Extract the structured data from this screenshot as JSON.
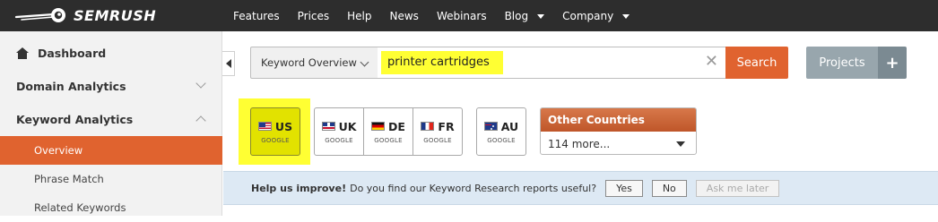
{
  "brand": {
    "logo_text": "SEMRUSH"
  },
  "nav": {
    "items": [
      {
        "label": "Features"
      },
      {
        "label": "Prices"
      },
      {
        "label": "Help"
      },
      {
        "label": "News"
      },
      {
        "label": "Webinars"
      },
      {
        "label": "Blog"
      },
      {
        "label": "Company"
      }
    ]
  },
  "sidebar": {
    "dashboard": "Dashboard",
    "domain_analytics": "Domain Analytics",
    "keyword_analytics": "Keyword Analytics",
    "sub_items": [
      {
        "label": "Overview",
        "active": true
      },
      {
        "label": "Phrase Match"
      },
      {
        "label": "Related Keywords"
      }
    ]
  },
  "search": {
    "database_select": "Keyword Overview",
    "query_value": "printer cartridges",
    "clear_glyph": "✕",
    "search_button": "Search",
    "projects_button": "Projects",
    "add_button": "+"
  },
  "countries": {
    "buttons": [
      {
        "code": "US",
        "engine": "GOOGLE",
        "selected": true
      },
      {
        "code": "UK",
        "engine": "GOOGLE"
      },
      {
        "code": "DE",
        "engine": "GOOGLE"
      },
      {
        "code": "FR",
        "engine": "GOOGLE"
      },
      {
        "code": "AU",
        "engine": "GOOGLE"
      }
    ],
    "other_title": "Other Countries",
    "other_selected": "114 more..."
  },
  "feedback": {
    "lead": "Help us improve!",
    "question": "Do you find our Keyword Research reports useful?",
    "yes": "Yes",
    "no": "No",
    "later": "Ask me later"
  },
  "colors": {
    "topbar": "#2d2d2d",
    "accent": "#e0632f",
    "highlight": "#ffff33",
    "projects": "#98a6ad",
    "feedback_bg": "#dde9f4"
  }
}
